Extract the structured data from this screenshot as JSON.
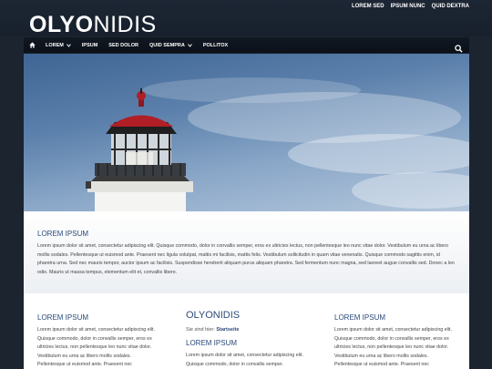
{
  "brand": {
    "logo_bold": "OLYO",
    "logo_light": "NIDIS"
  },
  "top_links": [
    "LOREM SED",
    "IPSUM NUNC",
    "QUID DEXTRA"
  ],
  "nav": {
    "home_icon": "home-icon",
    "items": [
      {
        "label": "LOREM",
        "has_dropdown": true
      },
      {
        "label": "IPSUM",
        "has_dropdown": false
      },
      {
        "label": "SED DOLOR",
        "has_dropdown": false
      },
      {
        "label": "QUID SEMPRA",
        "has_dropdown": true
      },
      {
        "label": "POLLITOX",
        "has_dropdown": false
      }
    ],
    "search_icon": "search-icon"
  },
  "intro": {
    "heading": "LOREM IPSUM",
    "text": "Lorem ipsum dolor sit amet, consectetur adipiscing elit. Quisque commodo, dolor in convallis semper, eros ex ultricies lectus, non pellentesque leo nunc vitae dolor. Vestibulum eu urna ac libero mollis sodales. Pellentesque ut euismod ante. Praesent nec ligula volutpat, mattis mi facilisis, mattis felis. Vestibulum sollicitudin in quam vitae venenatis. Quisque commodo sagittis enim, id pharetra urna. Sed nec mauris tempor, auctor ipsum ac facilisis. Suspendisse hendrerit aliquam purus aliquam pharetra. Sed fermentum nunc magna, sed laoreet augue convallis sed. Donec a leo odio. Mauris ut massa tempus, elementum elit et, convallis libero."
  },
  "columns": {
    "left": {
      "heading": "LOREM IPSUM",
      "text": "Lorem ipsum dolor sit amet, consectetur adipiscing elit. Quisque commodo, dolor in convallis semper, eros ex ultricies lectus, non pellentesque leo nunc vitae dolor. Vestibulum eu urna ac libero mollis sodales. Pellentesque ut euismod ante. Praesent nec"
    },
    "middle": {
      "title": "OLYONIDIS",
      "breadcrumb_prefix": "Sie sind hier:",
      "breadcrumb_link": "Startseite",
      "heading": "LOREM IPSUM",
      "text": "Lorem ipsum dolor sit amet, consectetur adipiscing elit. Quisque commodo, dolor in convallis semper."
    },
    "right": {
      "heading": "LOREM IPSUM",
      "text": "Lorem ipsum dolor sit amet, consectetur adipiscing elit. Quisque commodo, dolor in convallis semper, eros ex ultricies lectus, non pellentesque leo nunc vitae dolor. Vestibulum eu urna ac libero mollis sodales. Pellentesque ut euismod ante. Praesent nec"
    }
  },
  "colors": {
    "header_bg": "#1c2430",
    "accent_blue": "#2c4a7a",
    "lighthouse_roof": "#b01e26"
  }
}
